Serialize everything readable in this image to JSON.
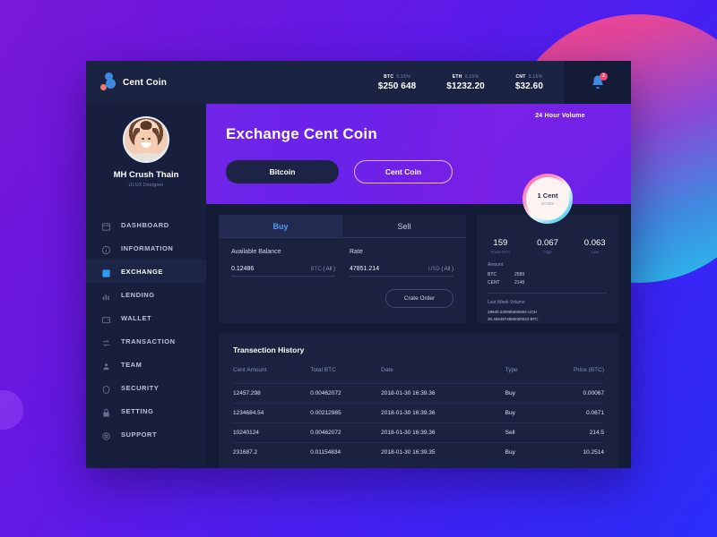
{
  "brand": {
    "name": "Cent Coin",
    "logo_icon": "cent-coin-logo-icon"
  },
  "tickers": [
    {
      "symbol": "BTC",
      "change": "0.15%",
      "value": "$250 648"
    },
    {
      "symbol": "ETH",
      "change": "0.15%",
      "value": "$1232.20"
    },
    {
      "symbol": "CNT",
      "change": "0.15%",
      "value": "$32.60"
    }
  ],
  "notifications": {
    "icon": "bell-icon",
    "count": "2"
  },
  "profile": {
    "name": "MH Crush Thain",
    "role": "UI.UX Designer",
    "avatar_icon": "user-avatar"
  },
  "sidebar": {
    "items": [
      {
        "label": "DASHBOARD",
        "icon": "dashboard-icon",
        "active": false
      },
      {
        "label": "INFORMATION",
        "icon": "info-icon",
        "active": false
      },
      {
        "label": "EXCHANGE",
        "icon": "exchange-icon",
        "active": true
      },
      {
        "label": "LENDING",
        "icon": "chart-bar-icon",
        "active": false
      },
      {
        "label": "WALLET",
        "icon": "wallet-icon",
        "active": false
      },
      {
        "label": "TRANSACTION",
        "icon": "transaction-icon",
        "active": false
      },
      {
        "label": "TEAM",
        "icon": "team-icon",
        "active": false
      },
      {
        "label": "SECURITY",
        "icon": "shield-icon",
        "active": false
      },
      {
        "label": "SETTING",
        "icon": "lock-icon",
        "active": false
      },
      {
        "label": "SUPPORT",
        "icon": "support-icon",
        "active": false
      }
    ]
  },
  "hero": {
    "title": "Exchange Cent Coin",
    "buttons": [
      {
        "label": "Bitcoin",
        "style": "solid"
      },
      {
        "label": "Cent Coin",
        "style": "ghost"
      }
    ]
  },
  "trade": {
    "tabs": [
      {
        "label": "Buy",
        "active": true
      },
      {
        "label": "Sell",
        "active": false
      }
    ],
    "balance": {
      "label": "Available Balance",
      "value": "0.12486",
      "unit": "BTC",
      "all": "( All )"
    },
    "rate": {
      "label": "Rate",
      "value": "47851.214",
      "unit": "USD",
      "all": "( All )"
    },
    "order_button": "Crate Order"
  },
  "volume": {
    "title": "24 Hour Volume",
    "coin": {
      "label": "1 Cent",
      "value": "$7.929"
    },
    "stats": [
      {
        "value": "159",
        "label": "Trade BTC"
      },
      {
        "value": "0.067",
        "label": "High"
      },
      {
        "value": "0.063",
        "label": "Low"
      }
    ],
    "amount": {
      "title": "Amount",
      "rows": [
        {
          "unit": "BTC",
          "value": "2589"
        },
        {
          "unit": "CENT",
          "value": "2148"
        }
      ]
    },
    "last_week": {
      "title": "Last Week  Volume",
      "lines": [
        "29940.230965690994 UOH",
        "30.4564974960000023 BTC"
      ]
    }
  },
  "history": {
    "title": "Transection History",
    "columns": [
      "Cent Amount",
      "Total BTC",
      "Date",
      "Type",
      "Price (BTC)"
    ],
    "rows": [
      [
        "12457.298",
        "0.00462072",
        "2018-01-30 16:39.36",
        "Buy",
        "0.00067"
      ],
      [
        "1234684.54",
        "0.00212985",
        "2018-01-30 16:39.36",
        "Buy",
        "0.0671"
      ],
      [
        "10240124",
        "0.00462072",
        "2018-01-30 16:39.36",
        "Sell",
        "214.5"
      ],
      [
        "231687.2",
        "0.01154834",
        "2018-01-30 16:39.35",
        "Buy",
        "10.2514"
      ]
    ]
  },
  "colors": {
    "accent": "#7024e8",
    "panel": "#1a2240",
    "window": "#141b36",
    "sidebar": "#171f3d",
    "active_blue": "#4a9ef5"
  }
}
